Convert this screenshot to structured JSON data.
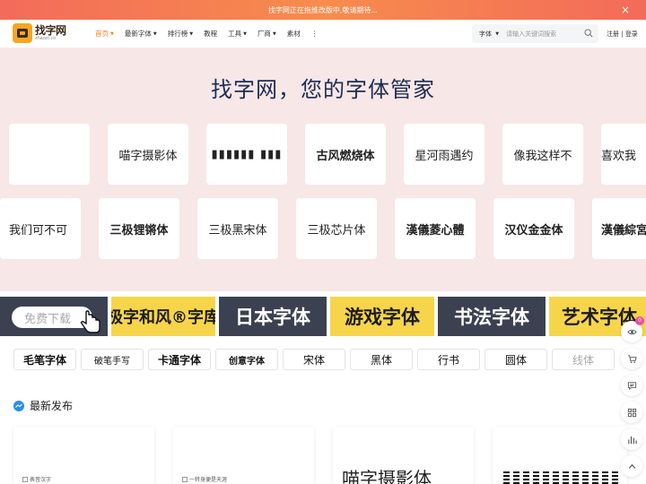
{
  "banner": {
    "text": "找字网正在拖维改版中,敬请期待...",
    "close": "×"
  },
  "logo": {
    "cn": "找字网",
    "en": "zhaozi.cn"
  },
  "nav": {
    "items": [
      {
        "label": "首页",
        "caret": "▼"
      },
      {
        "label": "最新字体",
        "caret": "▼"
      },
      {
        "label": "排行榜",
        "caret": "▼"
      },
      {
        "label": "教程",
        "caret": ""
      },
      {
        "label": "工具",
        "caret": "▼"
      },
      {
        "label": "厂商",
        "caret": "▼"
      },
      {
        "label": "素材",
        "caret": ""
      },
      {
        "label": "⋮",
        "caret": ""
      }
    ]
  },
  "search": {
    "type_label": "字体",
    "caret": "▼",
    "placeholder": "请输入关键词搜索"
  },
  "auth": {
    "register": "注册",
    "sep": " | ",
    "login": "登录"
  },
  "hero": {
    "title": "找字网，您的字体管家",
    "row1": [
      "",
      "喵字摄影体",
      "▮▮▮▮▮▮ ▮▮▮",
      "古风燃烧体",
      "星河雨遇约",
      "像我这样不",
      "喜欢我"
    ],
    "row2": [
      "我们可不可",
      "三极锂锵体",
      "三极黑宋体",
      "三极芯片体",
      "漢儀菱心體",
      "汉仪金金体",
      "漢儀綜宮"
    ]
  },
  "categories": {
    "free_download": "免费下载",
    "tiles": [
      "极字和风®字库",
      "日本字体",
      "游戏字体",
      "书法字体",
      "艺术字体"
    ]
  },
  "styles": [
    "毛笔字体",
    "破笔手写",
    "卡通字体",
    "创意字体",
    "宋体",
    "黑体",
    "行书",
    "圆体",
    "线体"
  ],
  "latest": {
    "title": "最新发布",
    "cards": [
      {
        "alt": "表音汉字"
      },
      {
        "alt": "一转身便是天涯"
      },
      {
        "preview": "喵字摄影体"
      },
      {
        "preview": ""
      }
    ]
  },
  "float": {
    "badge": "0"
  },
  "colors": {
    "accent": "#f5821f",
    "hero_bg": "#f7e7e7",
    "tile_dark": "#3b4150",
    "tile_yellow": "#f7d54a",
    "badge": "#f24ba3"
  }
}
